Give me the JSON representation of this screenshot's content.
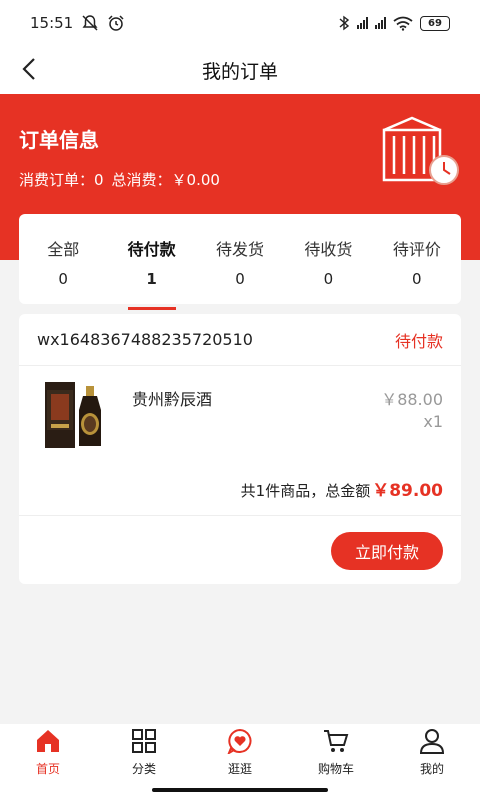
{
  "status_bar": {
    "time": "15:51",
    "battery": "69"
  },
  "nav": {
    "title": "我的订单"
  },
  "banner": {
    "title": "订单信息",
    "orders_label": "消费订单：0",
    "total_label": "总消费：￥0.00"
  },
  "order_tabs": [
    {
      "label": "全部",
      "count": "0"
    },
    {
      "label": "待付款",
      "count": "1"
    },
    {
      "label": "待发货",
      "count": "0"
    },
    {
      "label": "待收货",
      "count": "0"
    },
    {
      "label": "待评价",
      "count": "0"
    }
  ],
  "order": {
    "id": "wx1648367488235720510",
    "status": "待付款",
    "product_name": "贵州黔辰酒",
    "price": "￥88.00",
    "quantity": "x1",
    "summary_label": "共1件商品，总金额",
    "total": "￥89.00",
    "pay_button": "立即付款"
  },
  "tabbar": [
    {
      "label": "首页",
      "icon": "home-icon"
    },
    {
      "label": "分类",
      "icon": "grid-icon"
    },
    {
      "label": "逛逛",
      "icon": "heart-chat-icon"
    },
    {
      "label": "购物车",
      "icon": "cart-icon"
    },
    {
      "label": "我的",
      "icon": "user-icon"
    }
  ],
  "colors": {
    "accent": "#e63224",
    "background": "#f3f3f3"
  }
}
